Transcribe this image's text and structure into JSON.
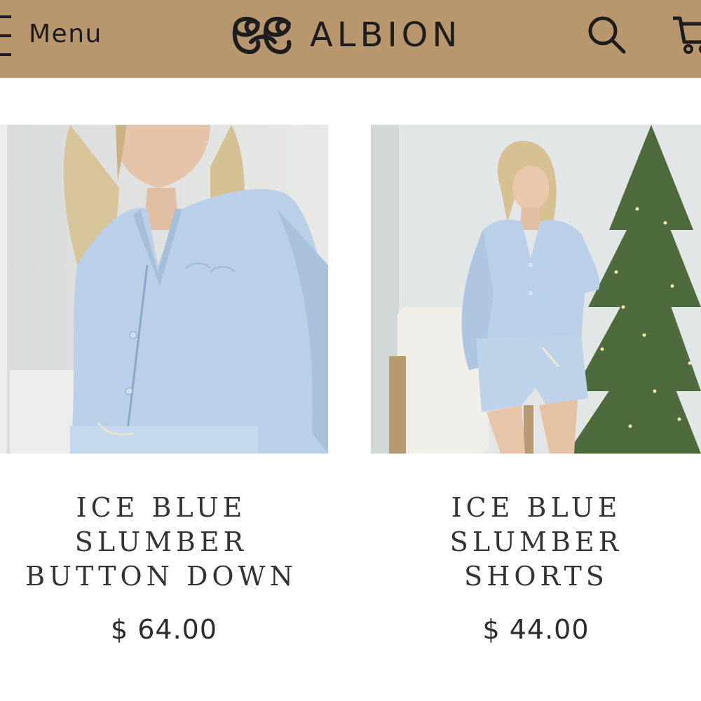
{
  "header": {
    "menu_label": "Menu",
    "brand_name": "ALBION",
    "logo_monogram": "AE",
    "background_color": "#b8976e"
  },
  "icons": {
    "menu": "hamburger-icon",
    "search": "search-icon",
    "cart": "cart-icon"
  },
  "products": [
    {
      "title_lines": [
        "ICE BLUE",
        "SLUMBER",
        "BUTTON DOWN"
      ],
      "price": "$ 64.00",
      "color": "#b7cde4"
    },
    {
      "title_lines": [
        "ICE BLUE",
        "SLUMBER",
        "SHORTS"
      ],
      "price": "$ 44.00",
      "color": "#b7cde4"
    }
  ]
}
